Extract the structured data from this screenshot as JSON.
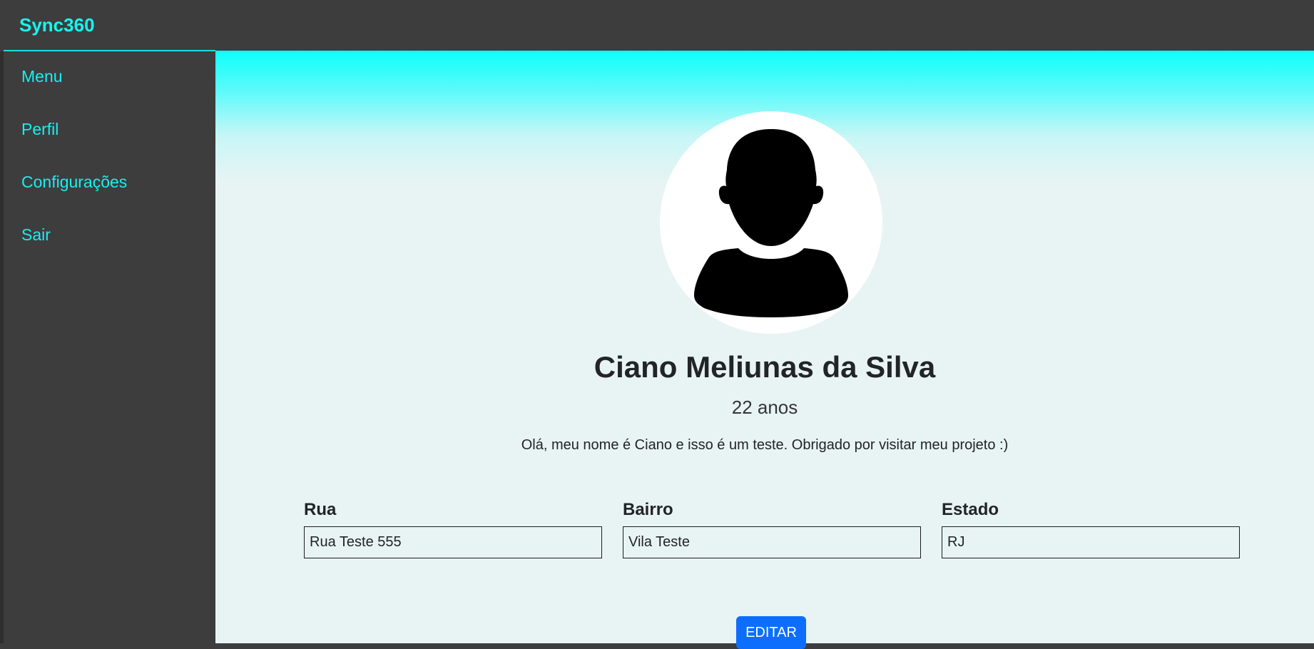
{
  "app": {
    "brand": "Sync360"
  },
  "sidebar": {
    "items": [
      {
        "label": "Menu"
      },
      {
        "label": "Perfil"
      },
      {
        "label": "Configurações"
      },
      {
        "label": "Sair"
      }
    ]
  },
  "profile": {
    "avatar_icon": "user-silhouette-icon",
    "name": "Ciano Meliunas da Silva",
    "age": "22 anos",
    "bio": "Olá, meu nome é Ciano e isso é um teste. Obrigado por visitar meu projeto :)"
  },
  "address": {
    "street_label": "Rua",
    "street_value": "Rua Teste 555",
    "district_label": "Bairro",
    "district_value": "Vila Teste",
    "state_label": "Estado",
    "state_value": "RJ"
  },
  "actions": {
    "edit_label": "EDITAR"
  },
  "colors": {
    "accent": "#17f5f2",
    "sidebar_bg": "#3d3d3d",
    "header_gradient_top": "#0dfffb",
    "content_bg": "#e8f4f4",
    "button_bg": "#0d6efd"
  }
}
